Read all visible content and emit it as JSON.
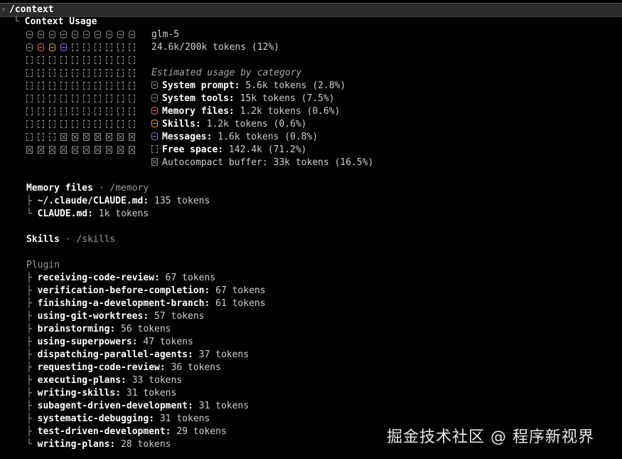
{
  "command": {
    "text": "/context",
    "prompt_mark": "›"
  },
  "header": {
    "tree_prefix": "└",
    "title": "Context Usage"
  },
  "summary": {
    "model": "glm-5",
    "usage": "24.6k/200k tokens (12%)",
    "used_fraction": 0.12
  },
  "grid": {
    "rows": [
      [
        "system",
        "system",
        "system",
        "system",
        "system",
        "system",
        "system",
        "system",
        "system",
        "system"
      ],
      [
        "system",
        "memory",
        "skills",
        "messages",
        "free",
        "free",
        "free",
        "free",
        "free",
        "free"
      ],
      [
        "free",
        "free",
        "free",
        "free",
        "free",
        "free",
        "free",
        "free",
        "free",
        "free"
      ],
      [
        "free",
        "free",
        "free",
        "free",
        "free",
        "free",
        "free",
        "free",
        "free",
        "free"
      ],
      [
        "free",
        "free",
        "free",
        "free",
        "free",
        "free",
        "free",
        "free",
        "free",
        "free"
      ],
      [
        "free",
        "free",
        "free",
        "free",
        "free",
        "free",
        "free",
        "free",
        "free",
        "free"
      ],
      [
        "free",
        "free",
        "free",
        "free",
        "free",
        "free",
        "free",
        "free",
        "free",
        "free"
      ],
      [
        "free",
        "free",
        "free",
        "free",
        "free",
        "free",
        "free",
        "free",
        "free",
        "free"
      ],
      [
        "free",
        "free",
        "free",
        "buffer",
        "buffer",
        "buffer",
        "buffer",
        "buffer",
        "buffer",
        "buffer"
      ],
      [
        "buffer",
        "buffer",
        "buffer",
        "buffer",
        "buffer",
        "buffer",
        "buffer",
        "buffer",
        "buffer",
        "buffer"
      ]
    ]
  },
  "categories": {
    "heading": "Estimated usage by category",
    "items": [
      {
        "key": "system",
        "icon": "database-icon",
        "color": "#8a8a8a",
        "label": "System prompt:",
        "value": " 5.6k tokens (2.8%)"
      },
      {
        "key": "tools",
        "icon": "database-icon",
        "color": "#8a8a8a",
        "label": "System tools:",
        "value": " 15k tokens (7.5%)"
      },
      {
        "key": "memory",
        "icon": "database-icon",
        "color": "#e06c5c",
        "label": "Memory files:",
        "value": " 1.2k tokens (0.6%)"
      },
      {
        "key": "skills",
        "icon": "database-icon",
        "color": "#e8a93b",
        "label": "Skills:",
        "value": " 1.2k tokens (0.6%)"
      },
      {
        "key": "messages",
        "icon": "database-icon",
        "color": "#9b6cf0",
        "label": "Messages:",
        "value": " 1.6k tokens (0.8%)"
      },
      {
        "key": "free",
        "icon": "free-space-icon",
        "color": "#8a8a8a",
        "label": "Free space:",
        "value": " 142.4k (71.2%)"
      },
      {
        "key": "buffer",
        "icon": "buffer-icon",
        "color": "#8a8a8a",
        "label": "",
        "value": "Autocompact buffer: 33k tokens (16.5%)"
      }
    ]
  },
  "memory_files": {
    "title": "Memory files",
    "sep": " · ",
    "path": "/memory",
    "items": [
      {
        "tree": "├ ",
        "name": "~/.claude/CLAUDE.md:",
        "tokens": " 135 tokens"
      },
      {
        "tree": "└ ",
        "name": "CLAUDE.md:",
        "tokens": " 1k tokens"
      }
    ]
  },
  "skills": {
    "title": "Skills",
    "sep": " · ",
    "path": "/skills",
    "group": "Plugin",
    "items": [
      {
        "tree": "├ ",
        "name": "receiving-code-review:",
        "tokens": " 67 tokens"
      },
      {
        "tree": "├ ",
        "name": "verification-before-completion:",
        "tokens": " 67 tokens"
      },
      {
        "tree": "├ ",
        "name": "finishing-a-development-branch:",
        "tokens": " 61 tokens"
      },
      {
        "tree": "├ ",
        "name": "using-git-worktrees:",
        "tokens": " 57 tokens"
      },
      {
        "tree": "├ ",
        "name": "brainstorming:",
        "tokens": " 56 tokens"
      },
      {
        "tree": "├ ",
        "name": "using-superpowers:",
        "tokens": " 47 tokens"
      },
      {
        "tree": "├ ",
        "name": "dispatching-parallel-agents:",
        "tokens": " 37 tokens"
      },
      {
        "tree": "├ ",
        "name": "requesting-code-review:",
        "tokens": " 36 tokens"
      },
      {
        "tree": "├ ",
        "name": "executing-plans:",
        "tokens": " 33 tokens"
      },
      {
        "tree": "├ ",
        "name": "writing-skills:",
        "tokens": " 31 tokens"
      },
      {
        "tree": "├ ",
        "name": "subagent-driven-development:",
        "tokens": " 31 tokens"
      },
      {
        "tree": "├ ",
        "name": "systematic-debugging:",
        "tokens": " 31 tokens"
      },
      {
        "tree": "├ ",
        "name": "test-driven-development:",
        "tokens": " 29 tokens"
      },
      {
        "tree": "└ ",
        "name": "writing-plans:",
        "tokens": " 28 tokens"
      }
    ]
  },
  "watermark": "掘金技术社区 @ 程序新视界"
}
